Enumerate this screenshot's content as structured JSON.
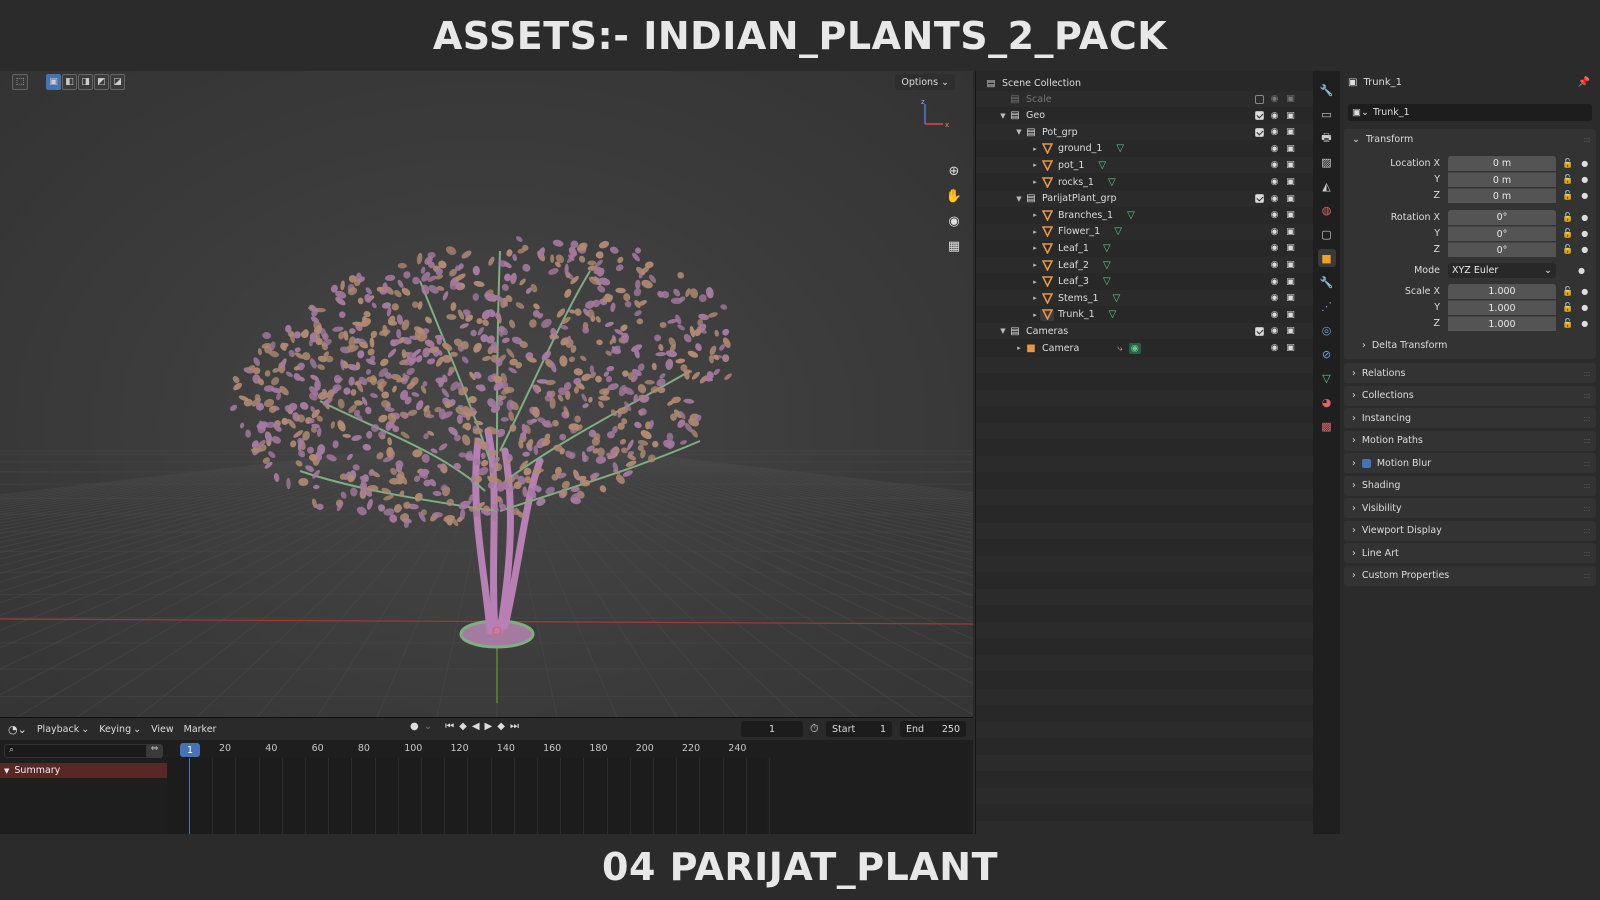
{
  "banner": {
    "top": "ASSETS:- INDIAN_PLANTS_2_PACK",
    "bottom": "04 PARIJAT_PLANT"
  },
  "viewport": {
    "options_label": "Options",
    "axis": {
      "x": "x",
      "z": "z"
    }
  },
  "timeline": {
    "menu": [
      "Playback",
      "Keying",
      "View",
      "Marker"
    ],
    "current_frame": "1",
    "start_label": "Start",
    "start_value": "1",
    "end_label": "End",
    "end_value": "250",
    "ruler_current": "1",
    "ruler": [
      "20",
      "40",
      "60",
      "80",
      "100",
      "120",
      "140",
      "160",
      "180",
      "200",
      "220",
      "240"
    ],
    "summary_label": "Summary"
  },
  "outliner": {
    "root": "Scene Collection",
    "rows": [
      {
        "label": "Scale",
        "type": "collection",
        "dim": true
      },
      {
        "label": "Geo",
        "type": "collection"
      },
      {
        "label": "Pot_grp",
        "type": "collection"
      },
      {
        "label": "ground_1",
        "type": "mesh"
      },
      {
        "label": "pot_1",
        "type": "mesh"
      },
      {
        "label": "rocks_1",
        "type": "mesh"
      },
      {
        "label": "ParijatPlant_grp",
        "type": "collection"
      },
      {
        "label": "Branches_1",
        "type": "mesh"
      },
      {
        "label": "Flower_1",
        "type": "mesh"
      },
      {
        "label": "Leaf_1",
        "type": "mesh"
      },
      {
        "label": "Leaf_2",
        "type": "mesh"
      },
      {
        "label": "Leaf_3",
        "type": "mesh"
      },
      {
        "label": "Stems_1",
        "type": "mesh"
      },
      {
        "label": "Trunk_1",
        "type": "mesh",
        "selected": true
      },
      {
        "label": "Cameras",
        "type": "collection"
      },
      {
        "label": "Camera",
        "type": "camera"
      }
    ]
  },
  "properties": {
    "object_name": "Trunk_1",
    "object_field": "Trunk_1",
    "transform_label": "Transform",
    "location_label": "Location X",
    "location": [
      "0 m",
      "0 m",
      "0 m"
    ],
    "rotation_label": "Rotation X",
    "rotation": [
      "0°",
      "0°",
      "0°"
    ],
    "mode_label": "Mode",
    "mode_value": "XYZ Euler",
    "scale_label": "Scale X",
    "scale": [
      "1.000",
      "1.000",
      "1.000"
    ],
    "axis_y": "Y",
    "axis_z": "Z",
    "delta_transform": "Delta Transform",
    "panels": [
      "Relations",
      "Collections",
      "Instancing",
      "Motion Paths",
      "Motion Blur",
      "Shading",
      "Visibility",
      "Viewport Display",
      "Line Art",
      "Custom Properties"
    ]
  },
  "colors": {
    "accent": "#4772b3",
    "active_tab": "#f5a020",
    "mesh_icon": "#e8954a",
    "modifier_icon": "#5bd18e",
    "leaf_pink": "#a57aa0",
    "leaf_peach": "#b08a72",
    "stem_green": "#7fae82"
  }
}
